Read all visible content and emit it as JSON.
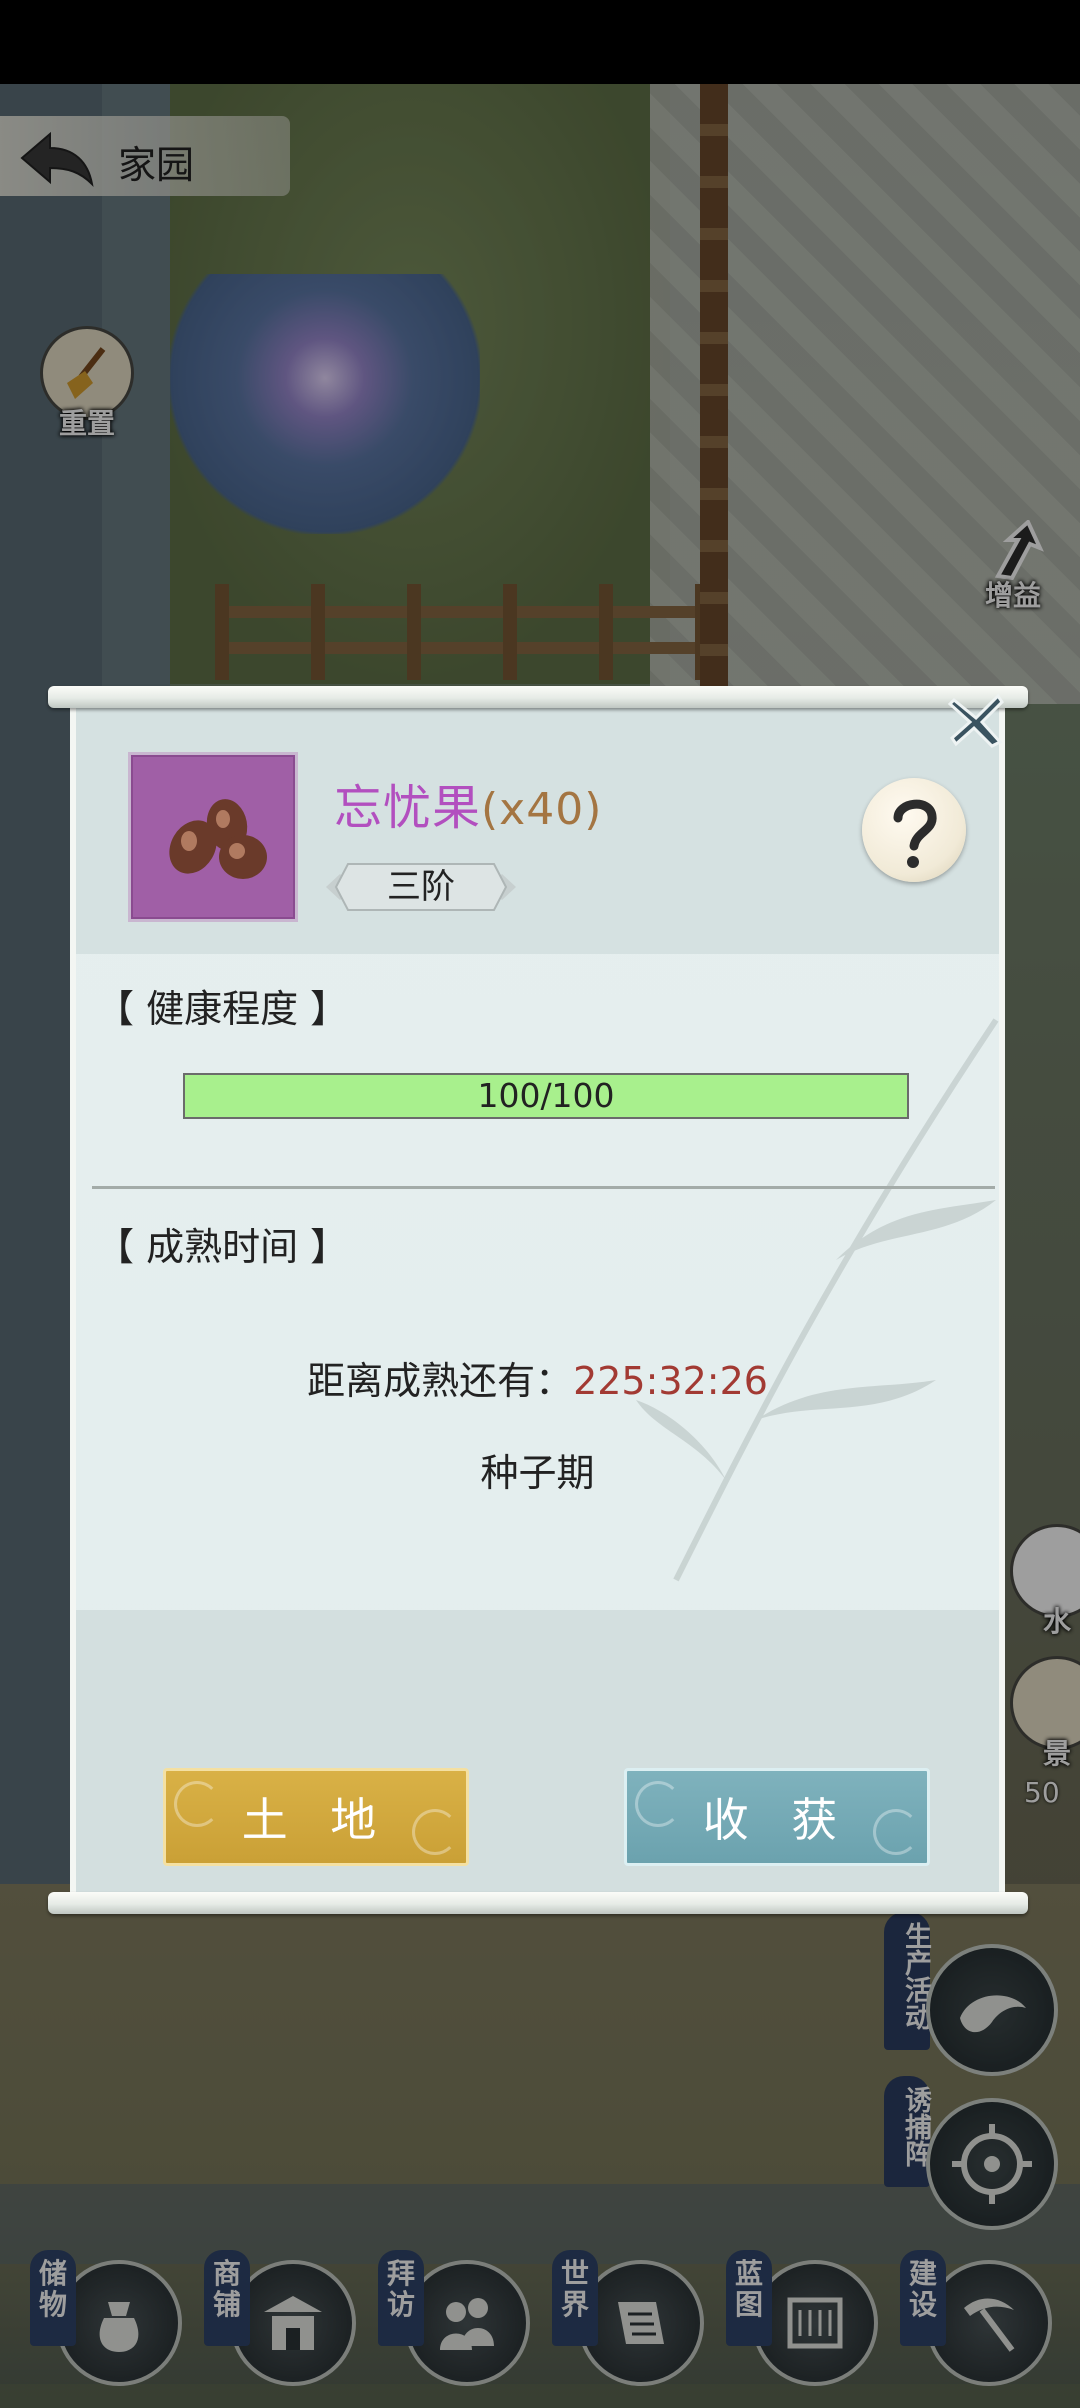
{
  "header": {
    "title": "家园"
  },
  "side_buttons": {
    "reset_label": "重置",
    "buff_label": "增益",
    "fengshui_partial": "水",
    "scenery_partial": "景",
    "count_partial": "50"
  },
  "right_tags": {
    "production": "生产活动",
    "trap": "诱捕阵"
  },
  "dock": [
    {
      "label": "储物",
      "icon": "bag-icon"
    },
    {
      "label": "商铺",
      "icon": "shop-icon"
    },
    {
      "label": "拜访",
      "icon": "visit-icon"
    },
    {
      "label": "世界",
      "icon": "scroll-icon"
    },
    {
      "label": "蓝图",
      "icon": "blueprint-icon"
    },
    {
      "label": "建设",
      "icon": "pickaxe-icon"
    }
  ],
  "dialog": {
    "item_name": "忘忧果",
    "item_qty": "(x40)",
    "rank": "三阶",
    "health_title": "【 健康程度 】",
    "health_value": "100/100",
    "health_fraction": 1.0,
    "mature_title": "【 成熟时间 】",
    "mature_prefix": "距离成熟还有：",
    "mature_time": "225:32:26",
    "stage": "种子期",
    "land_button": "土 地",
    "harvest_button": "收 获"
  },
  "colors": {
    "item_name": "#b24fbf",
    "time_text": "#a23a33",
    "health_fill": "#a8f08d",
    "land_button": "#caa036",
    "harvest_button": "#6ba2ae"
  }
}
